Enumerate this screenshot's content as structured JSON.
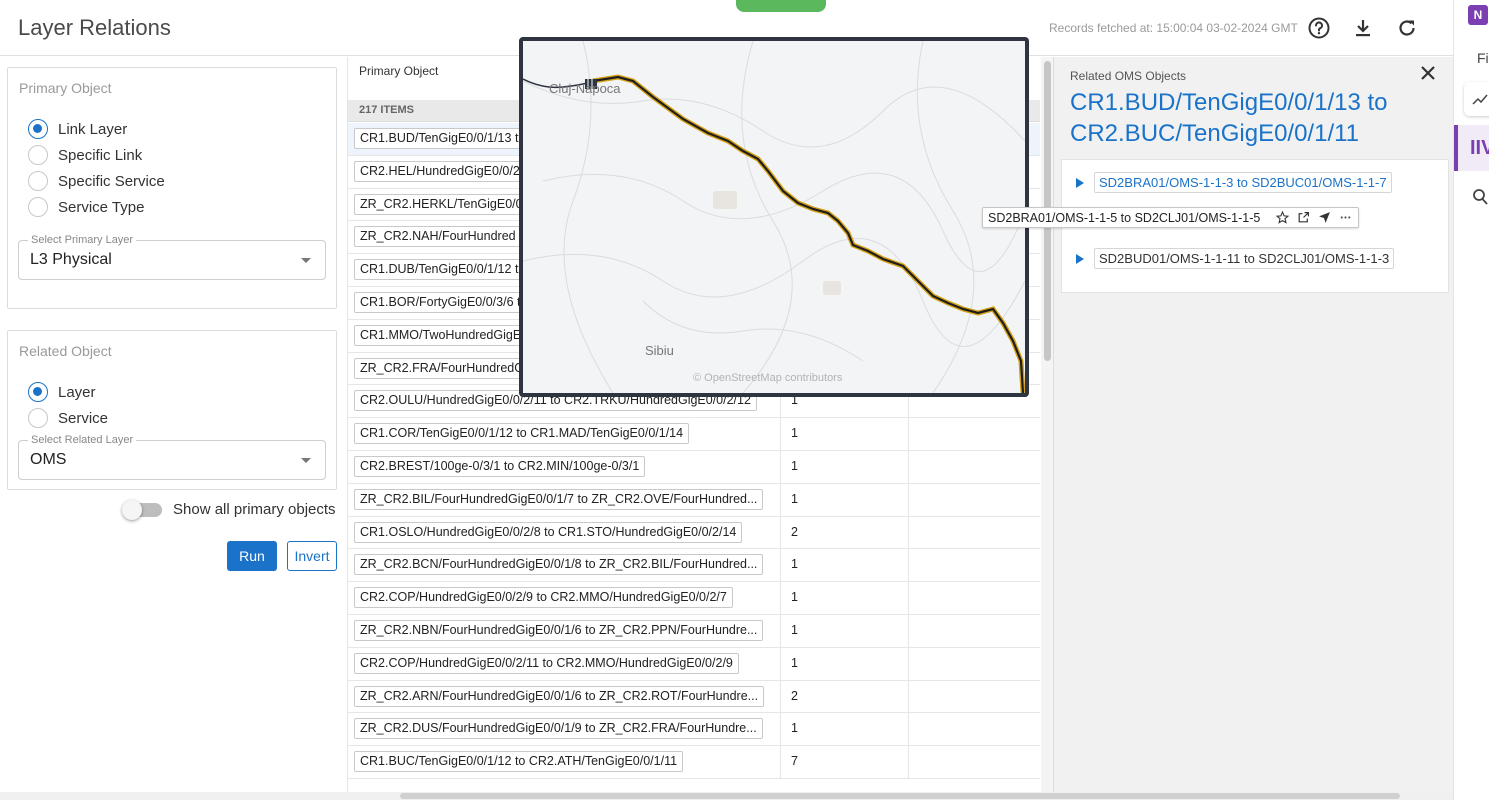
{
  "header": {
    "title": "Layer Relations",
    "records_fetched": "Records fetched at: 15:00:04 03-02-2024 GMT",
    "icons": [
      "help-icon",
      "download-icon",
      "refresh-icon"
    ]
  },
  "primary": {
    "label": "Primary Object",
    "options": [
      {
        "label": "Link Layer",
        "checked": true
      },
      {
        "label": "Specific Link",
        "checked": false
      },
      {
        "label": "Specific Service",
        "checked": false
      },
      {
        "label": "Service Type",
        "checked": false
      }
    ],
    "select_label": "Select Primary Layer",
    "select_value": "L3 Physical"
  },
  "related": {
    "label": "Related Object",
    "options": [
      {
        "label": "Layer",
        "checked": true
      },
      {
        "label": "Service",
        "checked": false
      }
    ],
    "select_label": "Select Related Layer",
    "select_value": "OMS"
  },
  "toggle": {
    "label": "Show all primary objects",
    "on": false
  },
  "buttons": {
    "run": "Run",
    "invert": "Invert"
  },
  "table": {
    "column1": "Primary Object",
    "item_count": "217 ITEMS",
    "rows": [
      {
        "name": "CR1.BUD/TenGigE0/0/1/13 t",
        "count": ""
      },
      {
        "name": "CR2.HEL/HundredGigE0/0/2",
        "count": ""
      },
      {
        "name": "ZR_CR2.HERKL/TenGigE0/0",
        "count": ""
      },
      {
        "name": "ZR_CR2.NAH/FourHundred",
        "count": ""
      },
      {
        "name": "CR1.DUB/TenGigE0/0/1/12 t",
        "count": ""
      },
      {
        "name": "CR1.BOR/FortyGigE0/0/3/6 t",
        "count": ""
      },
      {
        "name": "CR1.MMO/TwoHundredGigE",
        "count": ""
      },
      {
        "name": "ZR_CR2.FRA/FourHundredG",
        "count": ""
      },
      {
        "name": "CR2.OULU/HundredGigE0/0/2/11 to CR2.TRKU/HundredGigE0/0/2/12",
        "count": "1"
      },
      {
        "name": "CR1.COR/TenGigE0/0/1/12 to CR1.MAD/TenGigE0/0/1/14",
        "count": "1"
      },
      {
        "name": "CR2.BREST/100ge-0/3/1 to CR2.MIN/100ge-0/3/1",
        "count": "1"
      },
      {
        "name": "ZR_CR2.BIL/FourHundredGigE0/0/1/7 to ZR_CR2.OVE/FourHundred...",
        "count": "1"
      },
      {
        "name": "CR1.OSLO/HundredGigE0/0/2/8 to CR1.STO/HundredGigE0/0/2/14",
        "count": "2"
      },
      {
        "name": "ZR_CR2.BCN/FourHundredGigE0/0/1/8 to ZR_CR2.BIL/FourHundred...",
        "count": "1"
      },
      {
        "name": "CR2.COP/HundredGigE0/0/2/9 to CR2.MMO/HundredGigE0/0/2/7",
        "count": "1"
      },
      {
        "name": "ZR_CR2.NBN/FourHundredGigE0/0/1/6 to ZR_CR2.PPN/FourHundre...",
        "count": "1"
      },
      {
        "name": "CR2.COP/HundredGigE0/0/2/11 to CR2.MMO/HundredGigE0/0/2/9",
        "count": "1"
      },
      {
        "name": "ZR_CR2.ARN/FourHundredGigE0/0/1/6 to ZR_CR2.ROT/FourHundre...",
        "count": "2"
      },
      {
        "name": "ZR_CR2.DUS/FourHundredGigE0/0/1/9 to ZR_CR2.FRA/FourHundre...",
        "count": "1"
      },
      {
        "name": "CR1.BUC/TenGigE0/0/1/12 to CR2.ATH/TenGigE0/0/1/11",
        "count": "7"
      }
    ]
  },
  "map": {
    "cities": [
      "Cluj-Napoca",
      "Sibiu"
    ],
    "attribution": "© OpenStreetMap contributors"
  },
  "related_panel": {
    "subtitle": "Related OMS Objects",
    "title": "CR1.BUD/TenGigE0/0/1/13 to CR2.BUC/TenGigE0/0/1/11",
    "items": [
      "SD2BRA01/OMS-1-1-3 to SD2BUC01/OMS-1-1-7",
      "SD2BRA01/OMS-1-1-5 to SD2CLJ01/OMS-1-1-5",
      "SD2BUD01/OMS-1-1-11 to SD2CLJ01/OMS-1-1-3"
    ]
  },
  "far_right": {
    "app_letter": "N",
    "label_fragment": "Fil",
    "tab_label": "IIV"
  },
  "colors": {
    "accent": "#1a73c8",
    "map_frame": "#2e3440",
    "route": "#d4a017"
  }
}
